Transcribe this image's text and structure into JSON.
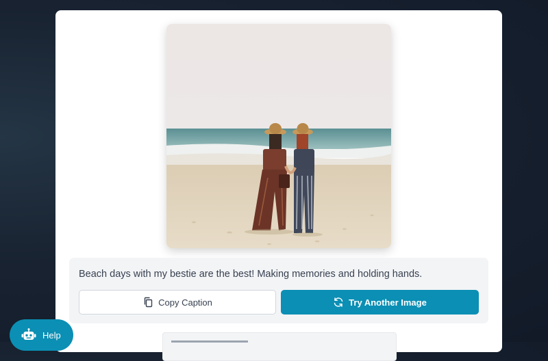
{
  "caption": {
    "text": "Beach days with my bestie are the best! Making memories and holding hands."
  },
  "actions": {
    "copy_label": "Copy Caption",
    "copy_icon": "copy-icon",
    "try_label": "Try Another Image",
    "try_icon": "refresh-icon"
  },
  "help": {
    "label": "Help",
    "icon": "robot-icon"
  },
  "colors": {
    "accent": "#0b8fb4",
    "card": "#ffffff",
    "panel": "#f3f4f6",
    "background": "#121a28"
  }
}
